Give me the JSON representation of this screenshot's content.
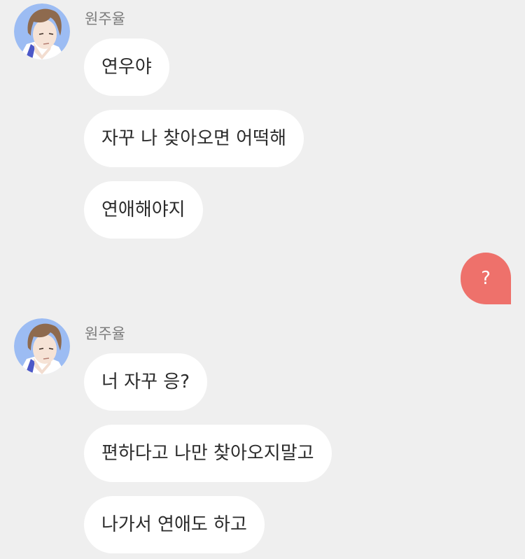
{
  "colors": {
    "background": "#efefef",
    "incoming_bubble": "#ffffff",
    "outgoing_bubble": "#ee716b",
    "sender_name_text": "#7b7b7b"
  },
  "messages": [
    {
      "sender": "원주율",
      "avatar_icon": "boy-portrait-icon",
      "bubbles": [
        "연우야",
        "자꾸 나 찾아오면 어떡해",
        "연애해야지"
      ]
    },
    {
      "outgoing": true,
      "text": "?"
    },
    {
      "sender": "원주율",
      "avatar_icon": "boy-portrait-icon",
      "bubbles": [
        "너 자꾸 응?",
        "편하다고 나만 찾아오지말고",
        "나가서 연애도 하고"
      ]
    }
  ]
}
